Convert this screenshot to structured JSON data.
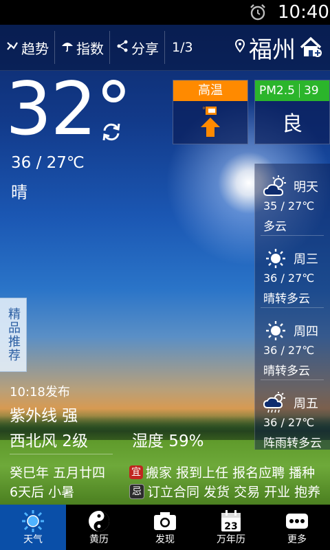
{
  "status": {
    "time": "10:40",
    "alarm_icon": "alarm-clock-icon"
  },
  "toolbar": {
    "trend_label": "趋势",
    "index_label": "指数",
    "share_label": "分享",
    "page_indicator": "1/3",
    "city": "福州"
  },
  "current": {
    "temperature": "32°",
    "range": "36  /  27℃",
    "condition": "晴"
  },
  "alert": {
    "label": "高温",
    "color": "#ff8a00"
  },
  "aqi": {
    "label": "PM2.5",
    "value": "39",
    "level": "良",
    "color": "#2bb52b"
  },
  "forecast": [
    {
      "day": "明天",
      "range": "35  /  27℃",
      "desc": "多云",
      "icon": "partly-cloudy-icon"
    },
    {
      "day": "周三",
      "range": "36  /  27℃",
      "desc": "晴转多云",
      "icon": "sunny-icon"
    },
    {
      "day": "周四",
      "range": "36  /  27℃",
      "desc": "晴转多云",
      "icon": "sunny-icon"
    },
    {
      "day": "周五",
      "range": "36  /  27℃",
      "desc": "阵雨转多云",
      "icon": "shower-icon"
    }
  ],
  "sidetab": {
    "label": "精品推荐"
  },
  "details": {
    "release": "10:18发布",
    "uv": "紫外线 强",
    "wind": "西北风 2级",
    "humidity": "湿度 59%"
  },
  "almanac": {
    "lunar_date": "癸巳年 五月廿四",
    "solar_term": "6天后  小暑",
    "yi_badge": "宜",
    "yi_text": "搬家 报到上任 报名应聘 播种",
    "ji_badge": "忌",
    "ji_text": "订立合同 发货 交易 开业 抱养"
  },
  "nav": {
    "weather": "天气",
    "almanac": "黄历",
    "discover": "发现",
    "calendar": "万年历",
    "calendar_day": "23",
    "more": "更多"
  }
}
